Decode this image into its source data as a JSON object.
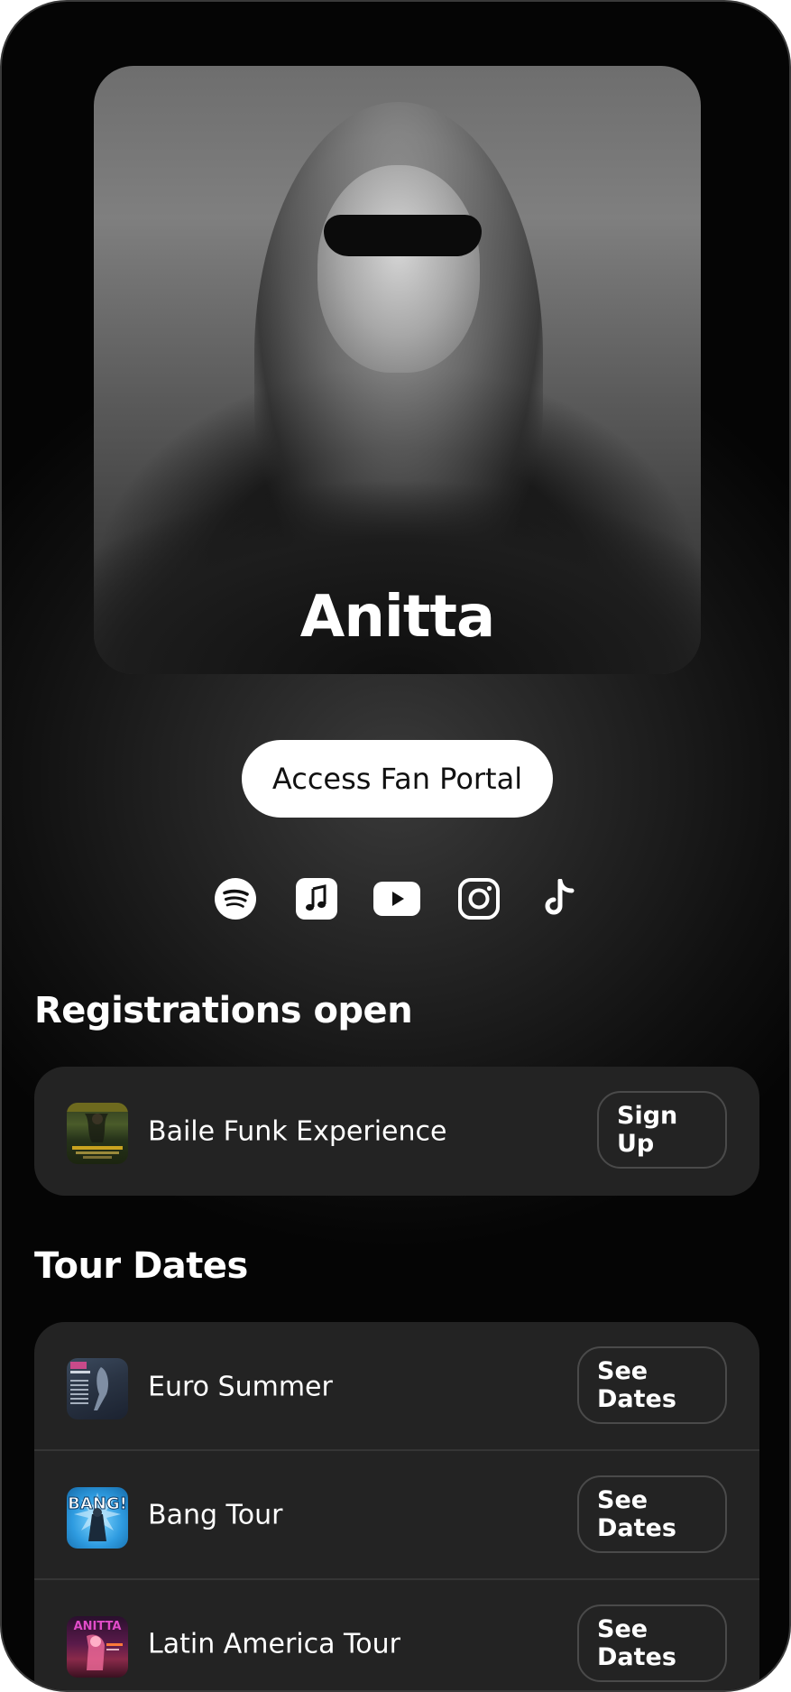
{
  "artist": {
    "name": "Anitta"
  },
  "portal_button": {
    "label": "Access Fan Portal"
  },
  "social_links": [
    {
      "icon": "spotify-icon"
    },
    {
      "icon": "apple-music-icon"
    },
    {
      "icon": "youtube-icon"
    },
    {
      "icon": "instagram-icon"
    },
    {
      "icon": "tiktok-icon"
    }
  ],
  "registrations": {
    "title": "Registrations open",
    "items": [
      {
        "title": "Baile Funk Experience",
        "button": "Sign Up"
      }
    ]
  },
  "tour_dates": {
    "title": "Tour Dates",
    "items": [
      {
        "title": "Euro Summer",
        "button": "See Dates"
      },
      {
        "title": "Bang Tour",
        "button": "See Dates"
      },
      {
        "title": "Latin America Tour",
        "button": "See Dates"
      }
    ]
  },
  "colors": {
    "background": "#0d0d0d",
    "card": "#232323",
    "button_border": "#4a4a4a",
    "text": "#ffffff"
  }
}
